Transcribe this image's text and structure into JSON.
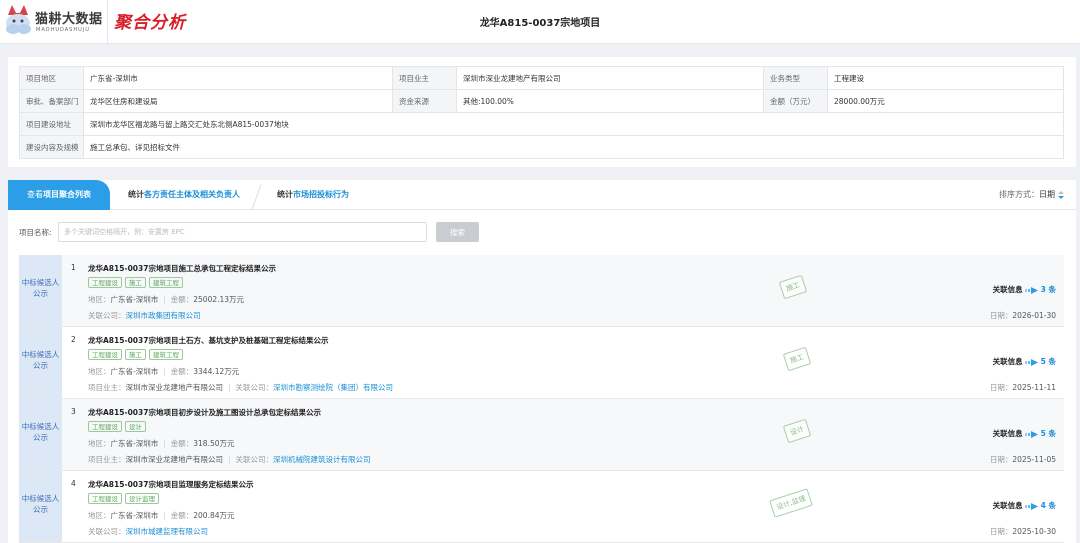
{
  "header": {
    "logo_name": "猫耕大数据",
    "logo_sub": "MAOHUDASHUJU",
    "app_title": "聚合分析",
    "project_title": "龙华A815-0037宗地项目"
  },
  "info": {
    "rows": [
      [
        {
          "key": "项目地区",
          "value": "广东省-深圳市"
        },
        {
          "key": "项目业主",
          "value": "深圳市深业龙建地产有限公司"
        },
        {
          "key": "业务类型",
          "value": "工程建设"
        }
      ],
      [
        {
          "key": "审批、备案部门",
          "value": "龙华区住房和建设局"
        },
        {
          "key": "资金来源",
          "value": "其他:100.00%"
        },
        {
          "key": "金额（万元）",
          "value": "28000.00万元"
        }
      ]
    ],
    "address_key": "项目建设地址",
    "address_value": "深圳市龙华区福龙路与留上路交汇处东北侧A815-0037地块",
    "scope_key": "建设内容及规模",
    "scope_value": "施工总承包、详见招标文件"
  },
  "tabs": [
    {
      "pre": "查看",
      "hl": "项目聚合列表"
    },
    {
      "pre": "统计",
      "hl": "各方责任主体及相关负责人"
    },
    {
      "pre": "统计",
      "hl": "市场招投标行为"
    }
  ],
  "sort": {
    "label": "排序方式：",
    "value": "日期"
  },
  "search": {
    "label": "项目名称:",
    "placeholder": "多个关键词空格隔开，例：安置房 EPC",
    "button": "搜索"
  },
  "labels": {
    "region": "地区：",
    "amount": "金额：",
    "related_company": "关联公司：",
    "owner": "项目业主：",
    "related_info": "关联信息",
    "count_suffix": "条",
    "date": "日期："
  },
  "items": [
    {
      "side": "中标候选人公示",
      "num": "1",
      "title": "龙华A815-0037宗地项目施工总承包工程定标结果公示",
      "tags": [
        "工程建设",
        "施工",
        "建筑工程"
      ],
      "region": "广东省-深圳市",
      "amount": "25002.13万元",
      "owner": "",
      "company": "深圳市政集团有限公司",
      "stamp": "施工",
      "count": "3",
      "date": "2026-01-30"
    },
    {
      "side": "中标候选人公示",
      "num": "2",
      "title": "龙华A815-0037宗地项目土石方、基坑支护及桩基础工程定标结果公示",
      "tags": [
        "工程建设",
        "施工",
        "建筑工程"
      ],
      "region": "广东省-深圳市",
      "amount": "3344.12万元",
      "owner": "深圳市深业龙建地产有限公司",
      "company": "深圳市勘察测绘院（集团）有限公司",
      "stamp": "施工",
      "count": "5",
      "date": "2025-11-11"
    },
    {
      "side": "中标候选人公示",
      "num": "3",
      "title": "龙华A815-0037宗地项目初步设计及施工图设计总承包定标结果公示",
      "tags": [
        "工程建设",
        "设计"
      ],
      "region": "广东省-深圳市",
      "amount": "318.50万元",
      "owner": "深圳市深业龙建地产有限公司",
      "company": "深圳机械院建筑设计有限公司",
      "stamp": "设计",
      "count": "5",
      "date": "2025-11-05"
    },
    {
      "side": "中标候选人公示",
      "num": "4",
      "title": "龙华A815-0037宗地项目监理服务定标结果公示",
      "tags": [
        "工程建设",
        "设计监理"
      ],
      "region": "广东省-深圳市",
      "amount": "200.84万元",
      "owner": "",
      "company": "深圳市城建监理有限公司",
      "stamp": "设计,监理",
      "count": "4",
      "date": "2025-10-30"
    }
  ],
  "colors": {
    "accent": "#2c9ee8",
    "brand_red": "#d81e2a",
    "link": "#1a8fd6",
    "tag_green": "#5aa85a"
  }
}
